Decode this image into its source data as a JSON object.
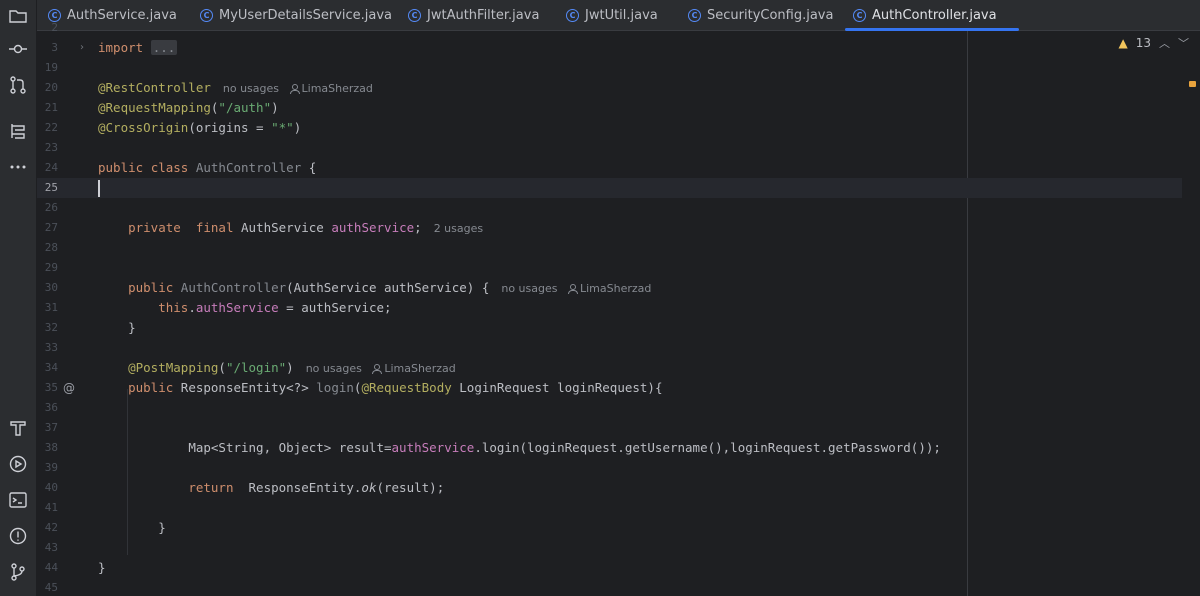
{
  "tabs": [
    {
      "label": "AuthService.java",
      "active": false
    },
    {
      "label": "MyUserDetailsService.java",
      "active": false
    },
    {
      "label": "JwtAuthFilter.java",
      "active": false
    },
    {
      "label": "JwtUtil.java",
      "active": false
    },
    {
      "label": "SecurityConfig.java",
      "active": false
    },
    {
      "label": "AuthController.java",
      "active": true
    }
  ],
  "inspection": {
    "warning_count": "13"
  },
  "colors": {
    "accent": "#3574f0",
    "keyword": "#cf8e6d",
    "annotation": "#b3ae60",
    "string": "#6aab73",
    "field": "#c77dbb"
  },
  "lines": [
    {
      "n": "2"
    },
    {
      "n": "3"
    },
    {
      "n": "19"
    },
    {
      "n": "20"
    },
    {
      "n": "21"
    },
    {
      "n": "22"
    },
    {
      "n": "23"
    },
    {
      "n": "24"
    },
    {
      "n": "25"
    },
    {
      "n": "26"
    },
    {
      "n": "27"
    },
    {
      "n": "28"
    },
    {
      "n": "29"
    },
    {
      "n": "30"
    },
    {
      "n": "31"
    },
    {
      "n": "32"
    },
    {
      "n": "33"
    },
    {
      "n": "34"
    },
    {
      "n": "35"
    },
    {
      "n": "36"
    },
    {
      "n": "37"
    },
    {
      "n": "38"
    },
    {
      "n": "39"
    },
    {
      "n": "40"
    },
    {
      "n": "41"
    },
    {
      "n": "42"
    },
    {
      "n": "43"
    },
    {
      "n": "44"
    },
    {
      "n": "45"
    }
  ],
  "code": {
    "import_kw": "import",
    "import_fold": "...",
    "rest_controller": "@RestController",
    "req_mapping": "@RequestMapping",
    "req_mapping_open": "(",
    "req_mapping_val": "\"/auth\"",
    "req_mapping_close": ")",
    "cross_origin": "@CrossOrigin",
    "cross_origin_args_open": "(origins = ",
    "cross_origin_val": "\"*\"",
    "cross_origin_close": ")",
    "public_kw": "public",
    "class_kw": "class",
    "class_name": "AuthController",
    "open_brace": "{",
    "private_kw": "private",
    "final_kw": "final",
    "auth_service_type": "AuthService",
    "auth_service_field": "authService",
    "semicolon": ";",
    "ctor_name": "AuthController",
    "ctor_params": "(AuthService authService) {",
    "this_kw": "this",
    "dot": ".",
    "assign_rest": " = authService;",
    "close_brace": "}",
    "post_mapping": "@PostMapping",
    "post_mapping_open": "(",
    "post_mapping_val": "\"/login\"",
    "post_mapping_close": ")",
    "response_entity_generic": "ResponseEntity<?>",
    "login_method": "login",
    "request_body": "@RequestBody",
    "login_params": " LoginRequest loginRequest){",
    "map_decl": "Map<String, Object> result=",
    "login_call": ".login(loginRequest.getUsername(),loginRequest.getPassword());",
    "return_kw": "return",
    "response_entity": "ResponseEntity.",
    "ok_method": "ok",
    "ok_args": "(result);"
  },
  "hints": {
    "no_usages": "no usages",
    "two_usages": "2 usages",
    "author": "LimaSherzad"
  }
}
